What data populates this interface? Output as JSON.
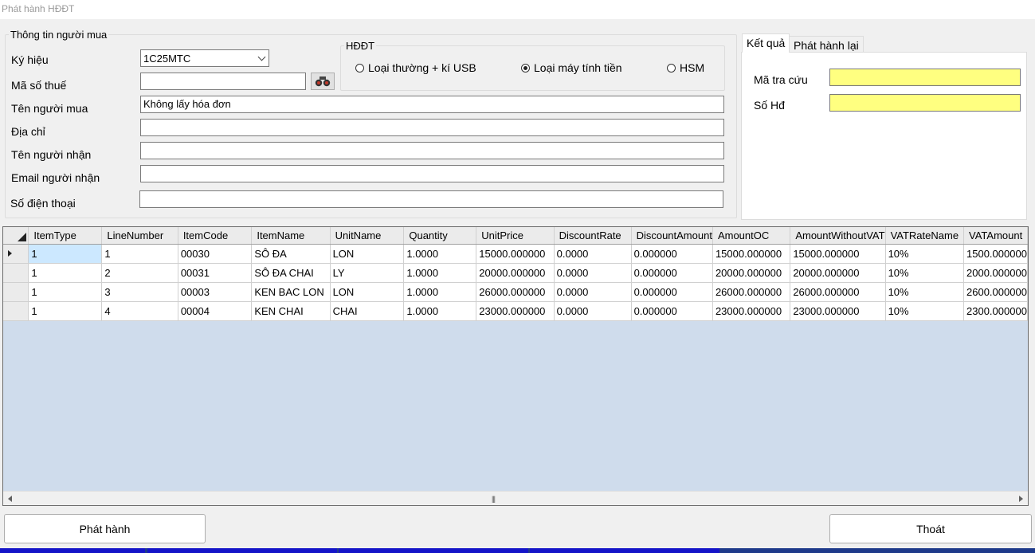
{
  "window": {
    "title": "Phát hành HĐĐT"
  },
  "buyer": {
    "legend": "Thông tin người mua",
    "symbol_label": "Ký hiệu",
    "symbol_value": "1C25MTC",
    "tax_label": "Mã số thuế",
    "tax_value": "",
    "name_label": "Tên người mua",
    "name_value": "Không lấy hóa đơn",
    "address_label": "Địa chỉ",
    "address_value": "",
    "receiver_label": "Tên người nhận",
    "receiver_value": "",
    "email_label": "Email người nhận",
    "email_value": "",
    "phone_label": "Số điện thoại",
    "phone_value": ""
  },
  "hddt": {
    "legend": "HĐĐT",
    "options": [
      {
        "label": "Loại thường + kí USB",
        "selected": false
      },
      {
        "label": "Loại máy tính tiền",
        "selected": true
      },
      {
        "label": "HSM",
        "selected": false
      }
    ]
  },
  "result": {
    "tabs": [
      "Kết quả",
      "Phát hành lại"
    ],
    "lookup_label": "Mã tra cứu",
    "lookup_value": "",
    "invoice_no_label": "Số Hđ",
    "invoice_no_value": ""
  },
  "grid": {
    "columns": [
      "ItemType",
      "LineNumber",
      "ItemCode",
      "ItemName",
      "UnitName",
      "Quantity",
      "UnitPrice",
      "DiscountRate",
      "DiscountAmount",
      "AmountOC",
      "AmountWithoutVAT",
      "VATRateName",
      "VATAmount"
    ],
    "rows": [
      [
        "1",
        "1",
        "00030",
        "SÔ ĐA",
        "LON",
        "1.0000",
        "15000.000000",
        "0.0000",
        "0.000000",
        "15000.000000",
        "15000.000000",
        "10%",
        "1500.000000"
      ],
      [
        "1",
        "2",
        "00031",
        "SÔ ĐA CHAI",
        "LY",
        "1.0000",
        "20000.000000",
        "0.0000",
        "0.000000",
        "20000.000000",
        "20000.000000",
        "10%",
        "2000.000000"
      ],
      [
        "1",
        "3",
        "00003",
        "KEN BAC LON",
        "LON",
        "1.0000",
        "26000.000000",
        "0.0000",
        "0.000000",
        "26000.000000",
        "26000.000000",
        "10%",
        "2600.000000"
      ],
      [
        "1",
        "4",
        "00004",
        "KEN CHAI",
        "CHAI",
        "1.0000",
        "23000.000000",
        "0.0000",
        "0.000000",
        "23000.000000",
        "23000.000000",
        "10%",
        "2300.000000"
      ]
    ],
    "scroll_grip": "|||"
  },
  "buttons": {
    "issue": "Phát hành",
    "exit": "Thoát"
  }
}
